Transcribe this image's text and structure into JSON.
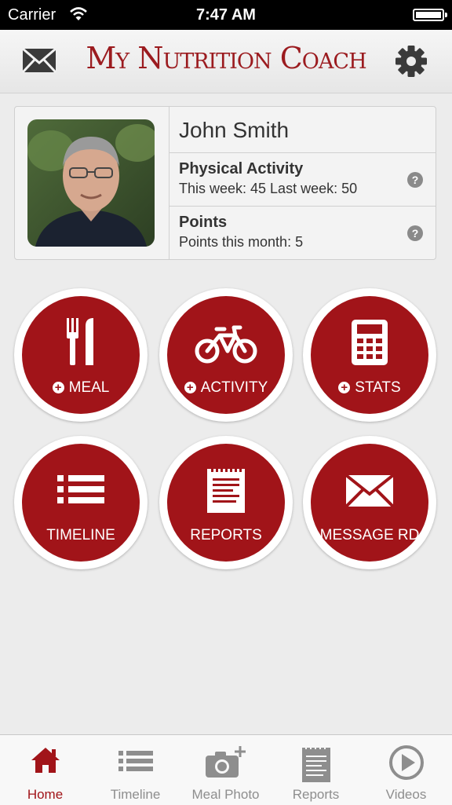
{
  "status_bar": {
    "carrier": "Carrier",
    "time": "7:47 AM"
  },
  "header": {
    "title": "My Nutrition Coach",
    "mail_icon": "mail-icon",
    "settings_icon": "gear-icon"
  },
  "profile": {
    "name": "John Smith",
    "activity": {
      "title": "Physical Activity",
      "detail": "This week: 45  Last week: 50"
    },
    "points": {
      "title": "Points",
      "detail": "Points this month: 5"
    }
  },
  "actions": [
    {
      "label": "MEAL",
      "icon": "fork-knife-icon"
    },
    {
      "label": "ACTIVITY",
      "icon": "bicycle-icon"
    },
    {
      "label": "STATS",
      "icon": "calculator-icon"
    },
    {
      "label": "TIMELINE",
      "icon": "list-icon"
    },
    {
      "label": "REPORTS",
      "icon": "report-icon"
    },
    {
      "label": "MESSAGE RD",
      "icon": "mail-icon"
    }
  ],
  "tabs": [
    {
      "label": "Home",
      "icon": "home-icon"
    },
    {
      "label": "Timeline",
      "icon": "list-icon"
    },
    {
      "label": "Meal Photo",
      "icon": "camera-plus-icon"
    },
    {
      "label": "Reports",
      "icon": "report-icon"
    },
    {
      "label": "Videos",
      "icon": "play-icon"
    }
  ],
  "colors": {
    "brand_red": "#a11419",
    "title_red": "#9b1b1f",
    "tab_inactive": "#8e8e8e"
  }
}
